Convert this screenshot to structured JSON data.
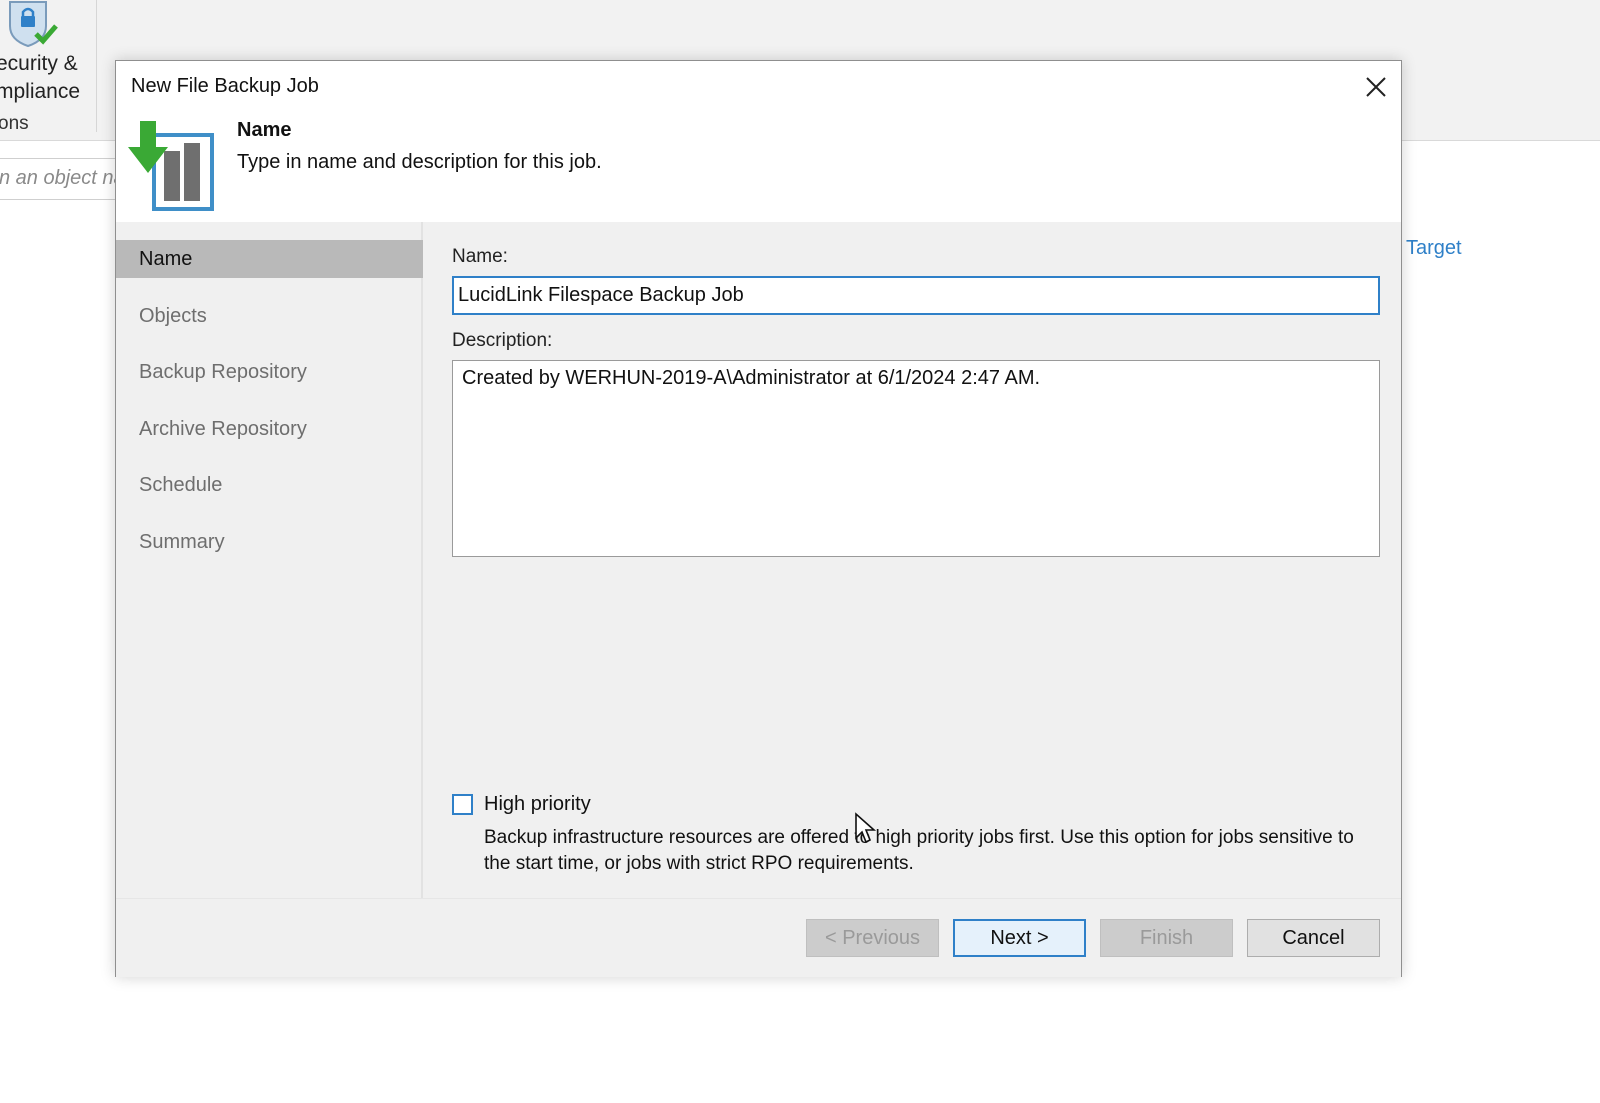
{
  "background": {
    "ribbon_labels": [
      "ecurity &",
      "mpliance"
    ],
    "ribbon_group_label": "ons",
    "search_placeholder": "n an object na",
    "target_link": "Target"
  },
  "dialog": {
    "title": "New File Backup Job",
    "header": {
      "title": "Name",
      "subtitle": "Type in name and description for this job."
    },
    "steps": [
      {
        "label": "Name",
        "active": true
      },
      {
        "label": "Objects"
      },
      {
        "label": "Backup Repository"
      },
      {
        "label": "Archive Repository"
      },
      {
        "label": "Schedule"
      },
      {
        "label": "Summary"
      }
    ],
    "form": {
      "name_label": "Name:",
      "name_value": "LucidLink Filespace Backup Job",
      "description_label": "Description:",
      "description_value": "Created by WERHUN-2019-A\\Administrator at 6/1/2024 2:47 AM.",
      "high_priority_label": "High priority",
      "high_priority_checked": false,
      "high_priority_description": "Backup infrastructure resources are offered to high priority jobs first. Use this option for jobs sensitive to the start time, or jobs with strict RPO requirements."
    },
    "buttons": {
      "previous": "< Previous",
      "next": "Next >",
      "finish": "Finish",
      "cancel": "Cancel"
    }
  },
  "colors": {
    "accent": "#2f80c8",
    "icon_green": "#3aa935",
    "active_step": "#b9b9b9",
    "panel_bg": "#f0f0f0"
  },
  "icons": {
    "ribbon": "shield-check-icon",
    "header": "file-backup-icon",
    "close": "close-icon",
    "cursor": "mouse-cursor-icon"
  }
}
